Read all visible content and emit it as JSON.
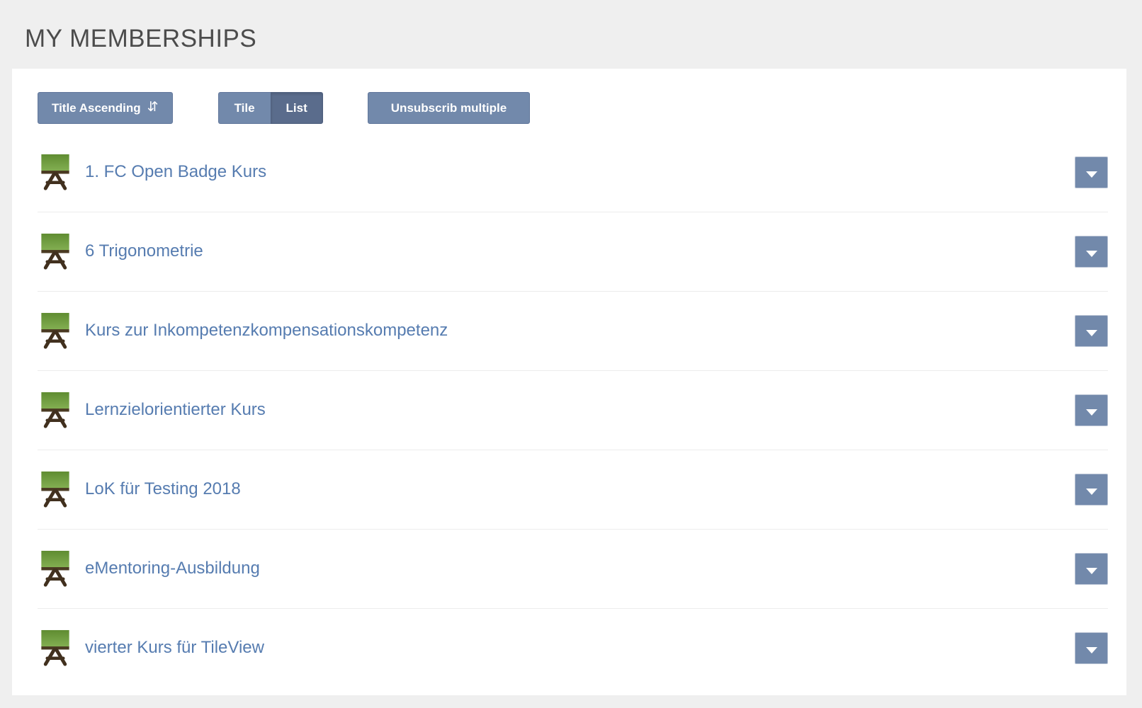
{
  "page": {
    "title": "MY MEMBERSHIPS"
  },
  "toolbar": {
    "sort": {
      "label": "Title Ascending",
      "icon_glyph": "⇵",
      "icon_name": "sort-ascending-descending-icon"
    },
    "view_toggle": {
      "tile_label": "Tile",
      "list_label": "List",
      "active": "List"
    },
    "unsubscribe_label": "Unsubscrib multiple"
  },
  "courses": {
    "icon_name": "course-chalkboard-icon",
    "row_menu_icon_name": "caret-down-icon",
    "items": [
      {
        "title": "1. FC Open Badge Kurs"
      },
      {
        "title": "6 Trigonometrie"
      },
      {
        "title": "Kurs zur Inkompetenzkompensationskompetenz"
      },
      {
        "title": "Lernzielorientierter Kurs"
      },
      {
        "title": "LoK für Testing 2018"
      },
      {
        "title": "eMentoring-Ausbildung"
      },
      {
        "title": "vierter Kurs für TileView"
      }
    ]
  },
  "colors": {
    "bg": "#efefef",
    "panel": "#ffffff",
    "heading": "#4c4c4c",
    "accent": "#7289ab",
    "accent_border": "#61779b",
    "accent_active": "#5a6c8c",
    "accent_active_border": "#4e5f7e",
    "link": "#567cb0",
    "separator": "#ececec",
    "menu_btn_border": "#b9c3d4",
    "board_green_top": "#5f8c31",
    "board_green_bottom": "#83af52",
    "board_tray": "#4a3a22",
    "easel_wood": "#41301e"
  }
}
